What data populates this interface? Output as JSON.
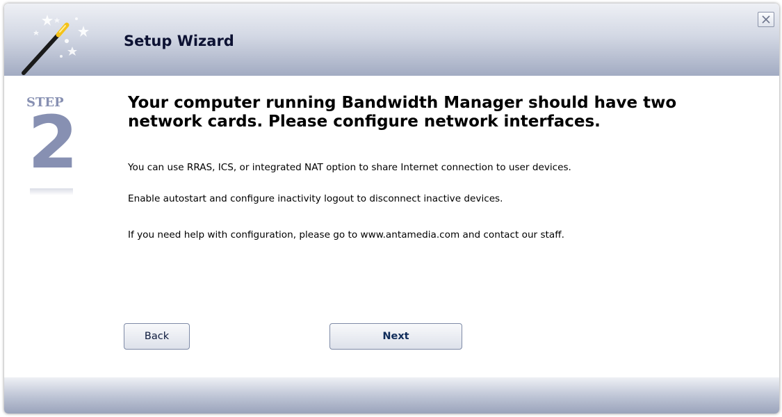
{
  "window": {
    "title": "Setup Wizard",
    "close_icon": "close-icon"
  },
  "header": {
    "icon": "magic-wand-icon"
  },
  "step": {
    "label": "STEP",
    "number": "2"
  },
  "content": {
    "headline": "Your computer running Bandwidth Manager should have two network cards. Please configure network interfaces.",
    "paragraphs": [
      "You can use RRAS, ICS, or integrated NAT option to share Internet connection to user devices.",
      "Enable autostart and configure inactivity logout to disconnect inactive devices.",
      "If you need help with configuration, please go to www.antamedia.com and contact our staff."
    ]
  },
  "buttons": {
    "back_label": "Back",
    "next_label": "Next"
  },
  "colors": {
    "header_gradient_top": "#eef0f5",
    "header_gradient_bottom": "#a2abc2",
    "step_color": "#8790b2",
    "title_color": "#0d1233"
  }
}
